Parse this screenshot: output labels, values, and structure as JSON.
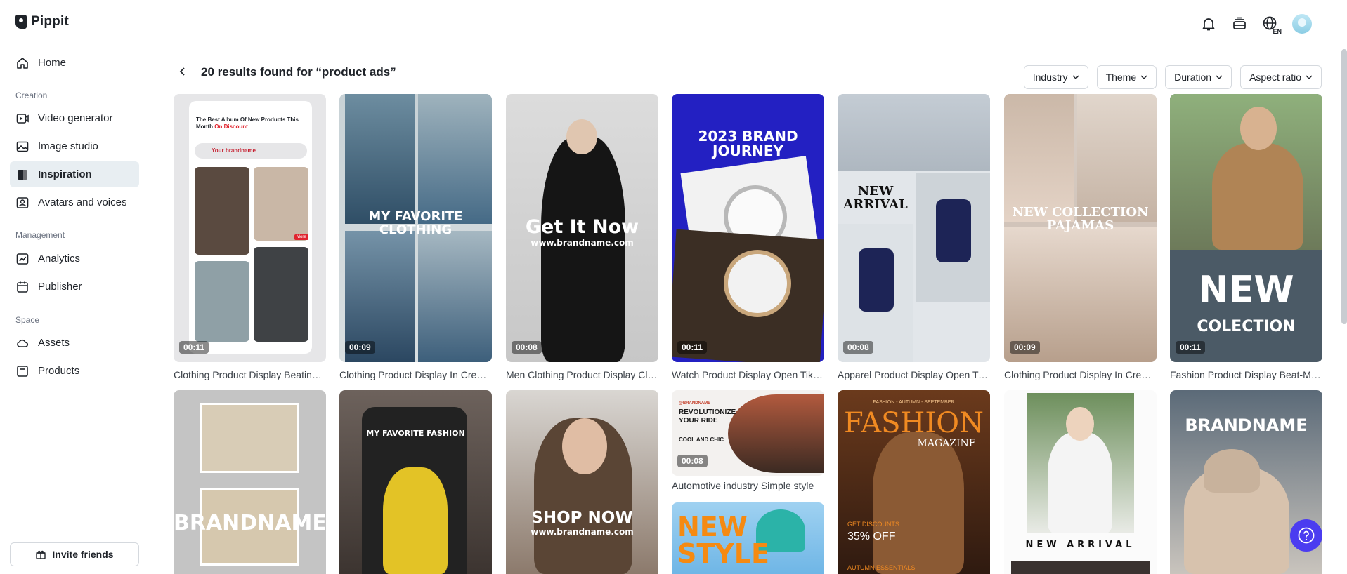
{
  "app": {
    "name": "Pippit",
    "lang": "EN"
  },
  "sidebar": {
    "home": "Home",
    "sections": [
      {
        "label": "Creation",
        "items": [
          "Video generator",
          "Image studio",
          "Inspiration",
          "Avatars and voices"
        ]
      },
      {
        "label": "Management",
        "items": [
          "Analytics",
          "Publisher"
        ]
      },
      {
        "label": "Space",
        "items": [
          "Assets",
          "Products"
        ]
      }
    ],
    "active": "Inspiration",
    "invite": "Invite friends"
  },
  "header": {
    "results": "20 results found for “product ads”",
    "filters": [
      "Industry",
      "Theme",
      "Duration",
      "Aspect ratio"
    ]
  },
  "cards": [
    {
      "title": "Clothing Product Display Beating Trends",
      "duration": "00:11",
      "overlay": {
        "heading": "The Best Album Of New Products This Month",
        "highlight": "On Discount",
        "search": "Your brandname",
        "badge": "More"
      }
    },
    {
      "title": "Clothing Product Display In Creative Style",
      "duration": "00:09",
      "overlay": "MY FAVORITE CLOTHING"
    },
    {
      "title": "Men Clothing Product Display Classic",
      "duration": "00:08",
      "overlay": "Get It Now",
      "sub": "www.brandname.com"
    },
    {
      "title": "Watch Product Display Open TikTok",
      "duration": "00:11",
      "overlay": "2023 BRAND JOURNEY"
    },
    {
      "title": "Apparel Product Display Open TikTok",
      "duration": "00:08",
      "overlay": "NEW ARRIVAL"
    },
    {
      "title": "Clothing Product Display In Creative Style",
      "duration": "00:09",
      "overlay": "NEW COLLECTION PAJAMAS"
    },
    {
      "title": "Fashion Product Display Beat-Matching",
      "duration": "00:11",
      "overlay": "NEW",
      "sub": "COLECTION"
    },
    {
      "overlay": "BRANDNAME"
    },
    {
      "overlay": "MY FAVORITE FASHION"
    },
    {
      "overlay": "SHOP NOW",
      "sub": "www.brandname.com"
    },
    {
      "title": "Automotive industry Simple style",
      "duration": "00:08",
      "overlay": "REVOLUTIONIZE YOUR RIDE",
      "sub": "COOL AND CHIC",
      "tag": "@BRANDNAME"
    },
    {
      "overlay": "NEW STYLE"
    },
    {
      "overlay": "FASHION",
      "sub": "MAGAZINE",
      "top": "FASHION - AUTUMN - SEPTEMBER",
      "promo": "GET DISCOUNTS",
      "promo2": "35% OFF",
      "foot": "AUTUMN ESSENTIALS"
    },
    {
      "overlay": "NEW ARRIVAL"
    },
    {
      "overlay": "BRANDNAME"
    }
  ],
  "colors": {
    "accent": "#4b3cf0",
    "active_bg": "#e8eef2"
  }
}
